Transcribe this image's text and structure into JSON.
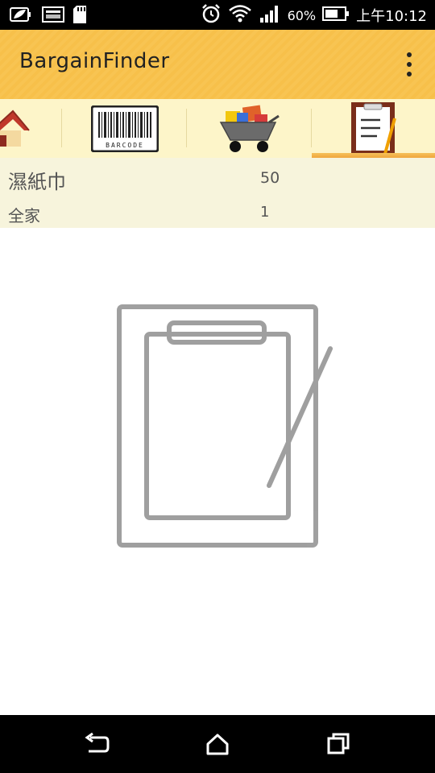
{
  "status_bar": {
    "battery_percent": "60%",
    "time": "上午10:12",
    "icons": [
      "leaf-icon",
      "image-icon",
      "sd-card-icon",
      "alarm-icon",
      "wifi-icon",
      "signal-icon",
      "battery-icon"
    ]
  },
  "app_bar": {
    "title": "BargainFinder",
    "menu_icon": "overflow-menu-icon"
  },
  "tabs": [
    {
      "icon": "house-icon",
      "active": false
    },
    {
      "icon": "barcode-icon",
      "barcode_text": "BARCODE",
      "active": false
    },
    {
      "icon": "shopping-cart-icon",
      "active": false
    },
    {
      "icon": "clipboard-icon",
      "active": true
    }
  ],
  "items": [
    {
      "name": "濕紙巾",
      "value": "50"
    },
    {
      "name": "全家",
      "value": "1"
    }
  ],
  "empty_state": {
    "icon": "clipboard-pencil-icon"
  },
  "nav_bar": {
    "icons": [
      "back-icon",
      "home-icon",
      "recents-icon"
    ]
  },
  "colors": {
    "app_bar": "#f8c452",
    "tab_strip": "#fdf5c9",
    "items_bg": "#f7f4dc",
    "active_tab_indicator": "#f0a63c"
  }
}
